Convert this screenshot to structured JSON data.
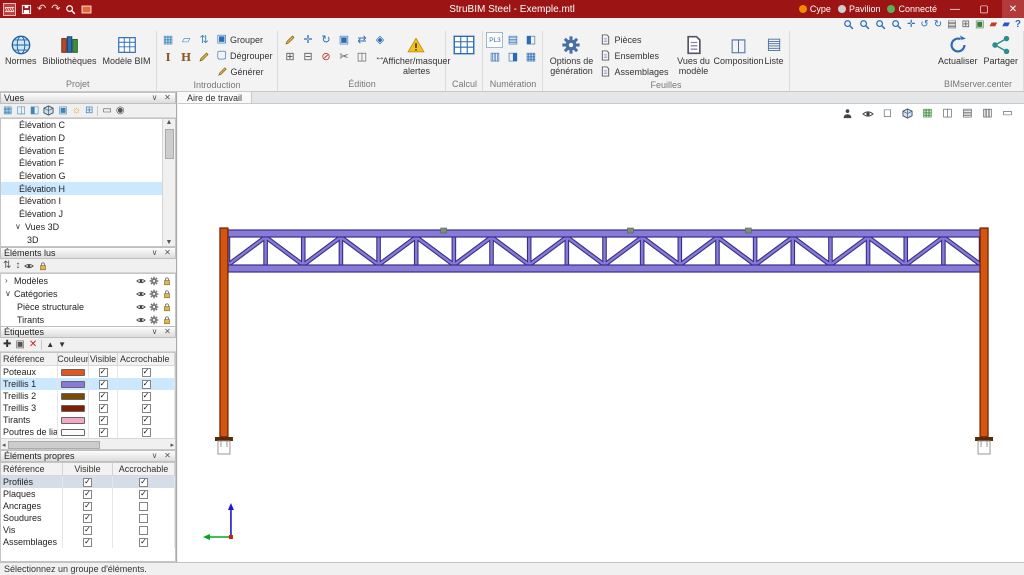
{
  "titlebar": {
    "title": "StruBIM Steel - Exemple.mtl",
    "account": "Cype",
    "org": "Pavilion",
    "connection": "Connecté"
  },
  "ribbon": {
    "projet": {
      "label": "Projet",
      "normes": "Normes",
      "bibliotheques": "Bibliothèques",
      "modele_bim": "Modèle BIM"
    },
    "introduction": {
      "label": "Introduction",
      "grouper": "Grouper",
      "degrouper": "Dégrouper",
      "generer": "Générer"
    },
    "edition": {
      "label": "Édition",
      "alertes": "Afficher/masquer alertes"
    },
    "calcul": {
      "label": "Calcul"
    },
    "numeration": {
      "label": "Numération",
      "pl3": "PL3"
    },
    "feuilles": {
      "label": "Feuilles",
      "options": "Options de génération",
      "pieces": "Pièces",
      "ensembles": "Ensembles",
      "assemblages": "Assemblages",
      "vues_modele": "Vues du modèle",
      "composition": "Composition",
      "liste": "Liste"
    },
    "bimserver": {
      "label": "BIMserver.center",
      "actualiser": "Actualiser",
      "partager": "Partager"
    }
  },
  "workspace": {
    "tab": "Aire de travail"
  },
  "vues": {
    "title": "Vues",
    "items": [
      {
        "label": "Élévation C",
        "selected": false
      },
      {
        "label": "Élévation D",
        "selected": false
      },
      {
        "label": "Élévation E",
        "selected": false
      },
      {
        "label": "Élévation F",
        "selected": false
      },
      {
        "label": "Élévation G",
        "selected": false
      },
      {
        "label": "Élévation H",
        "selected": true
      },
      {
        "label": "Élévation I",
        "selected": false
      },
      {
        "label": "Élévation J",
        "selected": false
      }
    ],
    "group_3d": {
      "label": "Vues 3D"
    },
    "item_3d": {
      "label": "3D"
    }
  },
  "elements_lus": {
    "title": "Éléments lus",
    "rows": [
      {
        "label": "Modèles"
      },
      {
        "label": "Catégories"
      },
      {
        "label": "Pièce structurale"
      },
      {
        "label": "Tirants"
      }
    ]
  },
  "etiquettes": {
    "title": "Étiquettes",
    "columns": {
      "ref": "Référence",
      "couleur": "Couleur",
      "visible": "Visible",
      "accrochable": "Accrochable"
    },
    "rows": [
      {
        "ref": "Poteaux",
        "color": "#e4551b",
        "visible": true,
        "accrochable": true,
        "selected": false
      },
      {
        "ref": "Treillis 1",
        "color": "#8878d8",
        "visible": true,
        "accrochable": true,
        "selected": true
      },
      {
        "ref": "Treillis 2",
        "color": "#7a4a07",
        "visible": true,
        "accrochable": true,
        "selected": false
      },
      {
        "ref": "Treillis 3",
        "color": "#801f04",
        "visible": true,
        "accrochable": true,
        "selected": false
      },
      {
        "ref": "Tirants",
        "color": "#f5a8c6",
        "visible": true,
        "accrochable": true,
        "selected": false
      },
      {
        "ref": "Poutres de liaison",
        "color": "#fbfbfb",
        "visible": true,
        "accrochable": true,
        "selected": false
      }
    ]
  },
  "elements_propres": {
    "title": "Éléments propres",
    "columns": {
      "ref": "Référence",
      "visible": "Visible",
      "accrochable": "Accrochable"
    },
    "rows": [
      {
        "ref": "Profilés",
        "visible": true,
        "accrochable": true,
        "selected": true
      },
      {
        "ref": "Plaques",
        "visible": true,
        "accrochable": true,
        "selected": false
      },
      {
        "ref": "Ancrages",
        "visible": true,
        "accrochable": false,
        "selected": false
      },
      {
        "ref": "Soudures",
        "visible": true,
        "accrochable": false,
        "selected": false
      },
      {
        "ref": "Vis",
        "visible": true,
        "accrochable": false,
        "selected": false
      },
      {
        "ref": "Assemblages",
        "visible": true,
        "accrochable": true,
        "selected": false
      }
    ]
  },
  "statusbar": {
    "message": "Sélectionnez un groupe d'éléments."
  }
}
